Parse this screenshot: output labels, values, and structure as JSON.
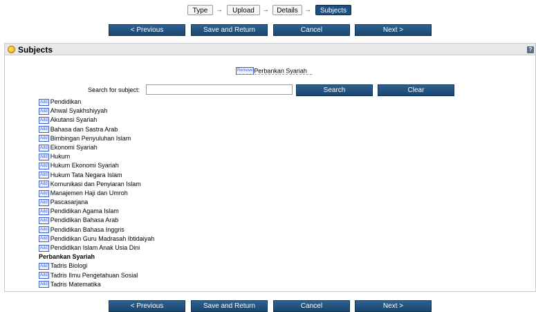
{
  "workflow": {
    "steps": [
      {
        "label": "Type",
        "active": false
      },
      {
        "label": "Upload",
        "active": false
      },
      {
        "label": "Details",
        "active": false
      },
      {
        "label": "Subjects",
        "active": true
      }
    ],
    "arrow": "→"
  },
  "nav": {
    "previous": "< Previous",
    "save_return": "Save and Return",
    "cancel": "Cancel",
    "next": "Next >"
  },
  "panel": {
    "title": "Subjects",
    "help": "?"
  },
  "selected": {
    "remove_label": "Remove",
    "subject": "Perbankan Syariah"
  },
  "search": {
    "label": "Search for subject:",
    "value": "",
    "search_button": "Search",
    "clear_button": "Clear"
  },
  "add_label": "Add",
  "subjects": [
    {
      "name": "Pendidikan",
      "selected": false
    },
    {
      "name": "Ahwal Syakhshiyyah",
      "selected": false
    },
    {
      "name": "Akutansi Syariah",
      "selected": false
    },
    {
      "name": "Bahasa dan Sastra Arab",
      "selected": false
    },
    {
      "name": "Bimbingan Penyuluhan Islam",
      "selected": false
    },
    {
      "name": "Ekonomi Syariah",
      "selected": false
    },
    {
      "name": "Hukum",
      "selected": false
    },
    {
      "name": "Hukum Ekonomi Syariah",
      "selected": false
    },
    {
      "name": "Hukum Tata Negara Islam",
      "selected": false
    },
    {
      "name": "Komunikasi dan Penyiaran Islam",
      "selected": false
    },
    {
      "name": "Manajemen Haji dan Umroh",
      "selected": false
    },
    {
      "name": "Pascasarjana",
      "selected": false
    },
    {
      "name": "Pendidikan Agama Islam",
      "selected": false
    },
    {
      "name": "Pendidikan Bahasa Arab",
      "selected": false
    },
    {
      "name": "Pendidikan Bahasa Inggris",
      "selected": false
    },
    {
      "name": "Pendidikan Guru Madrasah Ibtidaiyah",
      "selected": false
    },
    {
      "name": "Pendidikan Islam Anak Usia Dini",
      "selected": false
    },
    {
      "name": "Perbankan Syariah",
      "selected": true
    },
    {
      "name": "Tadris Biologi",
      "selected": false
    },
    {
      "name": "Tadris Ilmu Pengetahuan Sosial",
      "selected": false
    },
    {
      "name": "Tadris Matematika",
      "selected": false
    }
  ]
}
